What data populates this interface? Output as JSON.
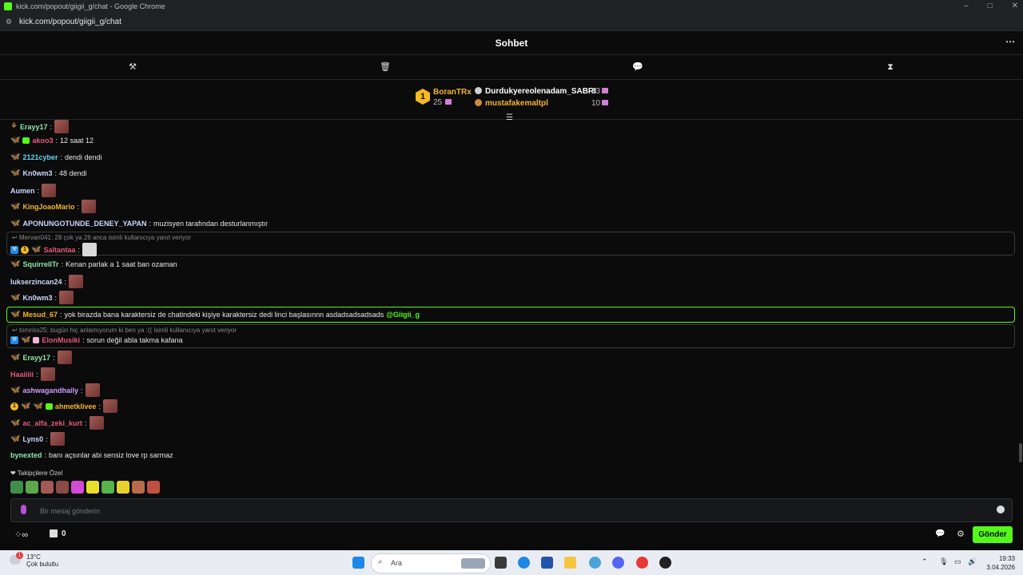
{
  "window": {
    "title": "kick.com/popout/giigii_g/chat - Google Chrome",
    "url": "kick.com/popout/giigii_g/chat"
  },
  "chat": {
    "title": "Sohbet"
  },
  "leaderboard": {
    "first": {
      "rank": "1",
      "name": "BoranTRx",
      "count": "25"
    },
    "others": [
      {
        "name": "Durdukyereolenadam_SABRI",
        "count": "13"
      },
      {
        "name": "mustafakemaltpl",
        "count": "10"
      }
    ]
  },
  "messages": [
    {
      "user": "Erayy17",
      "text": ""
    },
    {
      "user": "akoo3",
      "text": "12 saat 12"
    },
    {
      "user": "2121cyber",
      "text": "dendi dendi"
    },
    {
      "user": "Kn0wm3",
      "text": "48 dendi"
    },
    {
      "user": "Aumen",
      "text": ""
    },
    {
      "user": "KingJoaoMario",
      "text": ""
    },
    {
      "user": "APONUNGOTUNDE_DENEY_YAPAN",
      "text": "muzisyen tarafından desturlanmıştır"
    },
    {
      "reply_to": "Mervan041: 28 çok ya 26 anca isimli kullanıcıya yanıt veriyor",
      "user": "Saltantaa",
      "text": ""
    },
    {
      "user": "SquirrellTr",
      "text": "Kenan parlak a 1 saat ban ozaman"
    },
    {
      "user": "lukserzincan24",
      "text": ""
    },
    {
      "user": "Kn0wm3",
      "text": ""
    },
    {
      "user": "Mesud_67",
      "text": "yok birazda bana karaktersiz de chatindeki kişiye karaktersiz dedi linci başlasınnn asdadsadsadsads",
      "mention": "@Giigii_g"
    },
    {
      "reply_to": "tomriss25: bugün hiç anlamıyorum ki ben ya :(( isimli kullanıcıya yanıt veriyor",
      "user": "ElonMusiki",
      "text": "sorun değil abla takma kafana"
    },
    {
      "user": "Erayy17",
      "text": ""
    },
    {
      "user": "Haaiiiii",
      "text": ""
    },
    {
      "user": "ashwagandhaily",
      "text": ""
    },
    {
      "user": "ahmetklivee",
      "text": ""
    },
    {
      "user": "ac_alfa_zeki_kurt",
      "text": ""
    },
    {
      "user": "Lyns0",
      "text": ""
    },
    {
      "user": "bynexted",
      "text": "banı açsınlar abi sensiz love rp sarmaz"
    }
  ],
  "followers_only": "Takipçilere Özel",
  "input": {
    "placeholder": "Bir mesaj gönderin"
  },
  "footer": {
    "points": "0",
    "send_label": "Gönder"
  },
  "taskbar": {
    "temp": "13°C",
    "weather": "Çok bulutlu",
    "search": "Ara",
    "time": "19:33",
    "date": "3.04.2026",
    "weather_badge": "1"
  },
  "colors": {
    "accent": "#53fc18",
    "username_colors": [
      "#8ee6a7",
      "#e35a78",
      "#5fd7f0",
      "#f5b52a",
      "#cf9cff"
    ]
  }
}
